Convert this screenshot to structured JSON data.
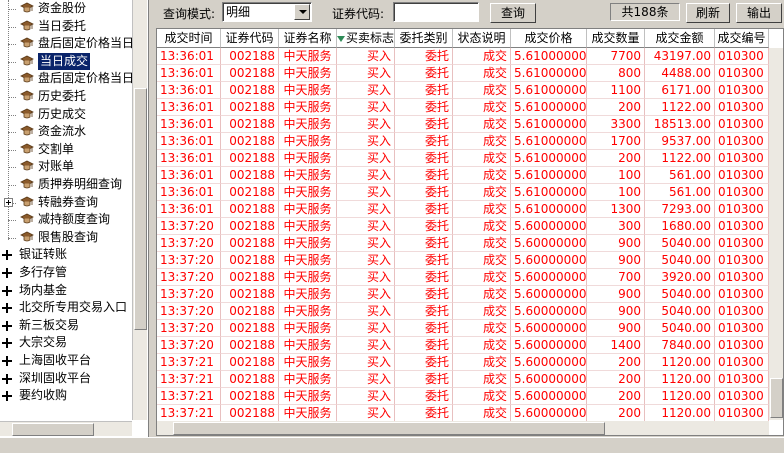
{
  "tree": {
    "sub_items": [
      {
        "label": "资金股份",
        "has_children": false
      },
      {
        "label": "当日委托",
        "has_children": false
      },
      {
        "label": "盘后固定价格当日",
        "has_children": false
      },
      {
        "label": "当日成交",
        "has_children": false,
        "selected": true
      },
      {
        "label": "盘后固定价格当日",
        "has_children": false
      },
      {
        "label": "历史委托",
        "has_children": false
      },
      {
        "label": "历史成交",
        "has_children": false
      },
      {
        "label": "资金流水",
        "has_children": false
      },
      {
        "label": "交割单",
        "has_children": false
      },
      {
        "label": "对账单",
        "has_children": false
      },
      {
        "label": "质押券明细查询",
        "has_children": false
      },
      {
        "label": "转融券查询",
        "has_children": true
      },
      {
        "label": "减持额度查询",
        "has_children": false
      },
      {
        "label": "限售股查询",
        "has_children": false
      }
    ],
    "root_items": [
      {
        "label": "银证转账"
      },
      {
        "label": "多行存管"
      },
      {
        "label": "场内基金"
      },
      {
        "label": "北交所专用交易入口"
      },
      {
        "label": "新三板交易"
      },
      {
        "label": "大宗交易"
      },
      {
        "label": "上海固收平台"
      },
      {
        "label": "深圳固收平台"
      },
      {
        "label": "要约收购"
      }
    ]
  },
  "toolbar": {
    "mode_label": "查询模式:",
    "mode_value": "明细",
    "code_label": "证券代码:",
    "code_value": "",
    "query_button": "查询",
    "total_count": "共188条",
    "refresh_button": "刷新",
    "export_button": "输出"
  },
  "grid": {
    "columns": [
      "成交时间",
      "证券代码",
      "证券名称",
      "买卖标志",
      "委托类别",
      "状态说明",
      "成交价格",
      "成交数量",
      "成交金额",
      "成交编号"
    ],
    "rows": [
      [
        "13:36:01",
        "002188",
        "中天服务",
        "买入",
        "委托",
        "成交",
        "5.61000000",
        "7700",
        "43197.00",
        "010300"
      ],
      [
        "13:36:01",
        "002188",
        "中天服务",
        "买入",
        "委托",
        "成交",
        "5.61000000",
        "800",
        "4488.00",
        "010300"
      ],
      [
        "13:36:01",
        "002188",
        "中天服务",
        "买入",
        "委托",
        "成交",
        "5.61000000",
        "1100",
        "6171.00",
        "010300"
      ],
      [
        "13:36:01",
        "002188",
        "中天服务",
        "买入",
        "委托",
        "成交",
        "5.61000000",
        "200",
        "1122.00",
        "010300"
      ],
      [
        "13:36:01",
        "002188",
        "中天服务",
        "买入",
        "委托",
        "成交",
        "5.61000000",
        "3300",
        "18513.00",
        "010300"
      ],
      [
        "13:36:01",
        "002188",
        "中天服务",
        "买入",
        "委托",
        "成交",
        "5.61000000",
        "1700",
        "9537.00",
        "010300"
      ],
      [
        "13:36:01",
        "002188",
        "中天服务",
        "买入",
        "委托",
        "成交",
        "5.61000000",
        "200",
        "1122.00",
        "010300"
      ],
      [
        "13:36:01",
        "002188",
        "中天服务",
        "买入",
        "委托",
        "成交",
        "5.61000000",
        "100",
        "561.00",
        "010300"
      ],
      [
        "13:36:01",
        "002188",
        "中天服务",
        "买入",
        "委托",
        "成交",
        "5.61000000",
        "100",
        "561.00",
        "010300"
      ],
      [
        "13:36:01",
        "002188",
        "中天服务",
        "买入",
        "委托",
        "成交",
        "5.61000000",
        "1300",
        "7293.00",
        "010300"
      ],
      [
        "13:37:20",
        "002188",
        "中天服务",
        "买入",
        "委托",
        "成交",
        "5.60000000",
        "300",
        "1680.00",
        "010300"
      ],
      [
        "13:37:20",
        "002188",
        "中天服务",
        "买入",
        "委托",
        "成交",
        "5.60000000",
        "900",
        "5040.00",
        "010300"
      ],
      [
        "13:37:20",
        "002188",
        "中天服务",
        "买入",
        "委托",
        "成交",
        "5.60000000",
        "900",
        "5040.00",
        "010300"
      ],
      [
        "13:37:20",
        "002188",
        "中天服务",
        "买入",
        "委托",
        "成交",
        "5.60000000",
        "700",
        "3920.00",
        "010300"
      ],
      [
        "13:37:20",
        "002188",
        "中天服务",
        "买入",
        "委托",
        "成交",
        "5.60000000",
        "900",
        "5040.00",
        "010300"
      ],
      [
        "13:37:20",
        "002188",
        "中天服务",
        "买入",
        "委托",
        "成交",
        "5.60000000",
        "900",
        "5040.00",
        "010300"
      ],
      [
        "13:37:20",
        "002188",
        "中天服务",
        "买入",
        "委托",
        "成交",
        "5.60000000",
        "900",
        "5040.00",
        "010300"
      ],
      [
        "13:37:20",
        "002188",
        "中天服务",
        "买入",
        "委托",
        "成交",
        "5.60000000",
        "1400",
        "7840.00",
        "010300"
      ],
      [
        "13:37:21",
        "002188",
        "中天服务",
        "买入",
        "委托",
        "成交",
        "5.60000000",
        "200",
        "1120.00",
        "010300"
      ],
      [
        "13:37:21",
        "002188",
        "中天服务",
        "买入",
        "委托",
        "成交",
        "5.60000000",
        "200",
        "1120.00",
        "010300"
      ],
      [
        "13:37:21",
        "002188",
        "中天服务",
        "买入",
        "委托",
        "成交",
        "5.60000000",
        "200",
        "1120.00",
        "010300"
      ],
      [
        "13:37:21",
        "002188",
        "中天服务",
        "买入",
        "委托",
        "成交",
        "5.60000000",
        "200",
        "1120.00",
        "010300"
      ]
    ]
  },
  "colors": {
    "row_text": "#ff0000",
    "selection": "#0a246a",
    "window_bg": "#d4d0c8"
  },
  "icons": {
    "leaf": "mortarboard-icon",
    "expand": "plus-icon",
    "sort": "sort-down-triangle-icon"
  }
}
